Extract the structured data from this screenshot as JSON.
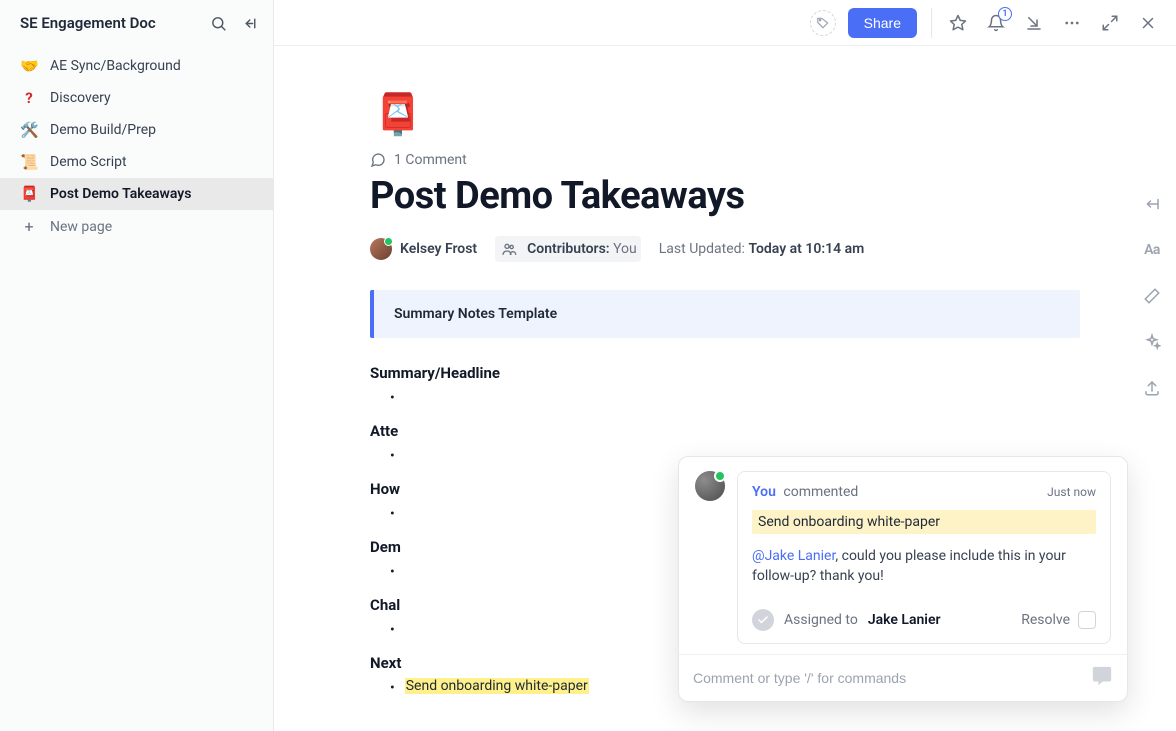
{
  "sidebar": {
    "title": "SE Engagement Doc",
    "items": [
      {
        "emoji": "🤝",
        "label": "AE Sync/Background"
      },
      {
        "emoji": "❓",
        "label": "Discovery"
      },
      {
        "emoji": "🛠️",
        "label": "Demo Build/Prep"
      },
      {
        "emoji": "📜",
        "label": "Demo Script"
      },
      {
        "emoji": "📮",
        "label": "Post Demo Takeaways"
      }
    ],
    "new_page_label": "New page"
  },
  "topbar": {
    "share_label": "Share",
    "notif_count": "1"
  },
  "doc": {
    "emoji": "📮",
    "comment_count_label": "1 Comment",
    "title": "Post Demo Takeaways",
    "author_name": "Kelsey Frost",
    "contributors_label": "Contributors:",
    "contributors_value": "You",
    "last_updated_label": "Last Updated:",
    "last_updated_value": "Today at 10:14 am",
    "callout_text": "Summary Notes Template",
    "sections": [
      "Summary/Headline",
      "Atte",
      "How",
      "Dem",
      "Chal",
      "Next"
    ],
    "highlighted_bullet": "Send onboarding white-paper"
  },
  "comment": {
    "who": "You",
    "action": "commented",
    "time": "Just now",
    "quote": "Send onboarding white-paper",
    "mention": "@Jake Lanier",
    "body_tail": ", could you please include this in your follow-up? thank you!",
    "assigned_label": "Assigned to",
    "assignee": "Jake Lanier",
    "resolve_label": "Resolve",
    "input_placeholder": "Comment or type '/' for commands"
  }
}
